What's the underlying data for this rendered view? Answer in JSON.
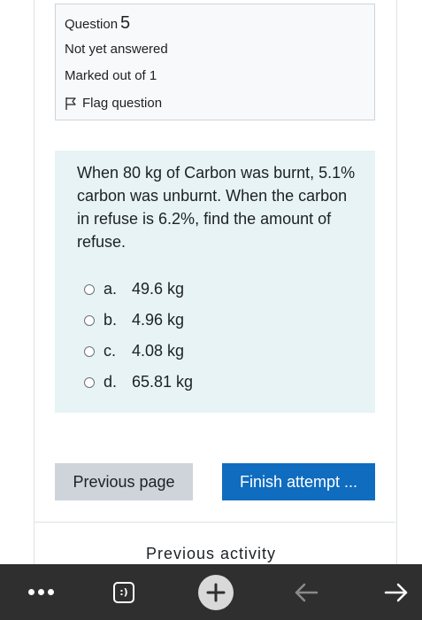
{
  "question_info": {
    "label": "Question",
    "number": "5",
    "status": "Not yet answered",
    "marks": "Marked out of 1",
    "flag_label": "Flag question"
  },
  "question": {
    "text": "When 80 kg of Carbon was burnt, 5.1% carbon was unburnt. When the carbon in refuse is 6.2%, find the amount of refuse.",
    "answers": [
      {
        "letter": "a.",
        "value": "49.6 kg"
      },
      {
        "letter": "b.",
        "value": "4.96 kg"
      },
      {
        "letter": "c.",
        "value": "4.08 kg"
      },
      {
        "letter": "d.",
        "value": "65.81 kg"
      }
    ]
  },
  "navigation": {
    "previous_page": "Previous page",
    "finish_attempt": "Finish attempt ...",
    "previous_activity": "Previous activity"
  },
  "browser_bar": {
    "tab_label": ":)",
    "icons": [
      "more-icon",
      "tabs-icon",
      "new-tab-icon",
      "back-icon",
      "forward-icon"
    ]
  },
  "colors": {
    "question_bg": "#e7f3f5",
    "finish_button": "#0f6cbf",
    "previous_button": "#ced4da",
    "bottom_bar": "#2f2f2f"
  }
}
